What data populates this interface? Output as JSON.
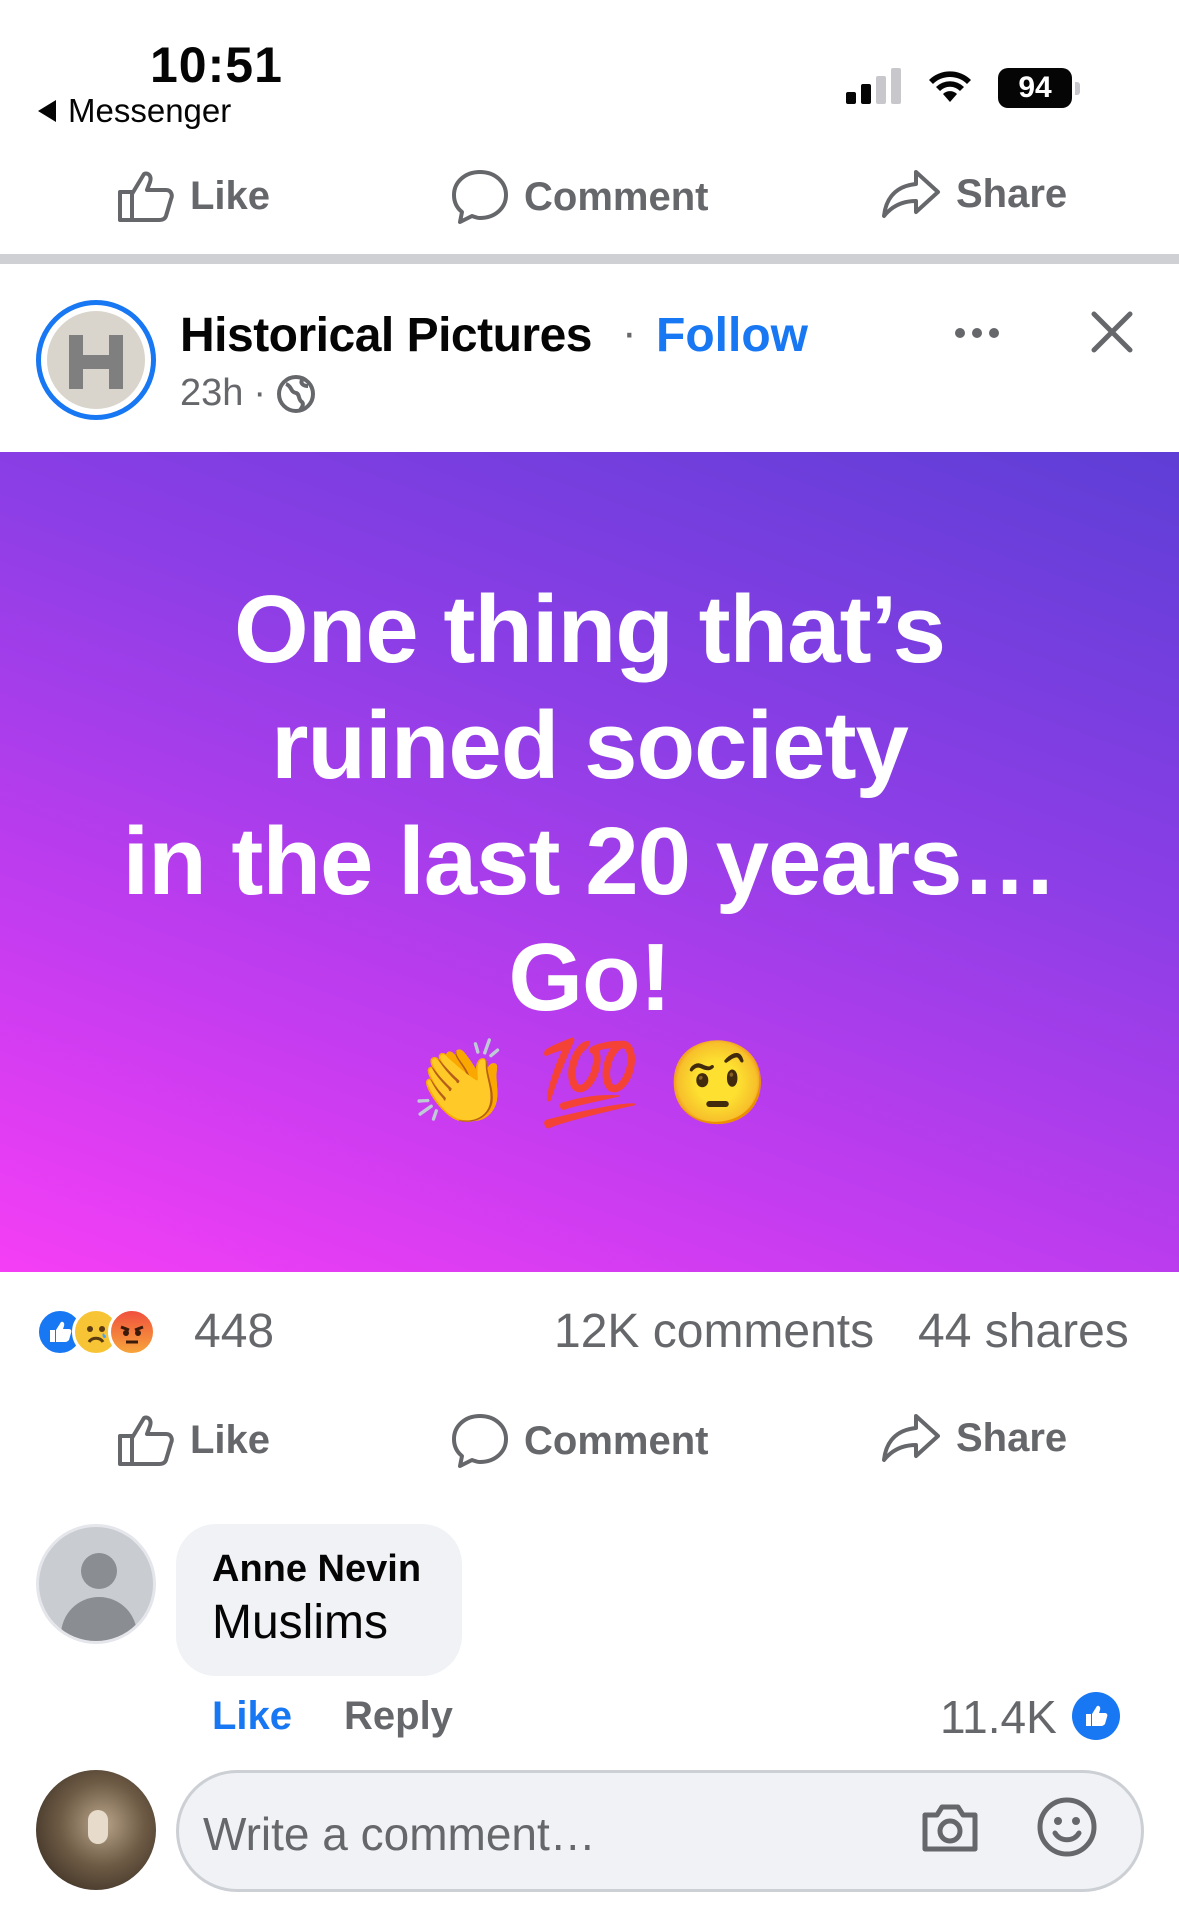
{
  "status_bar": {
    "time": "10:51",
    "back_app": "Messenger",
    "battery": "94"
  },
  "top_actions": {
    "like": "Like",
    "comment": "Comment",
    "share": "Share"
  },
  "post": {
    "page_name": "Historical Pictures",
    "separator": "·",
    "follow": "Follow",
    "time": "23h",
    "meta_separator": "·",
    "privacy_icon": "globe-icon",
    "text_lines": [
      "One thing that’s",
      "ruined society",
      "in the last 20 years…",
      "Go!"
    ],
    "emojis": "👏 💯 🤨",
    "gradient_colors": [
      "#5e3ed6",
      "#8d3ee6",
      "#c53cf0",
      "#f53ef5"
    ]
  },
  "stats": {
    "reaction_icons": [
      "like-icon",
      "sad-icon",
      "angry-icon"
    ],
    "reactions": "448",
    "comments": "12K comments",
    "shares": "44 shares"
  },
  "bottom_actions": {
    "like": "Like",
    "comment": "Comment",
    "share": "Share"
  },
  "comment": {
    "author": "Anne Nevin",
    "text": "Muslims",
    "like": "Like",
    "reply": "Reply",
    "reaction_count": "11.4K"
  },
  "composer": {
    "placeholder": "Write a comment…"
  },
  "colors": {
    "accent": "#1877f2",
    "muted": "#65676b"
  }
}
